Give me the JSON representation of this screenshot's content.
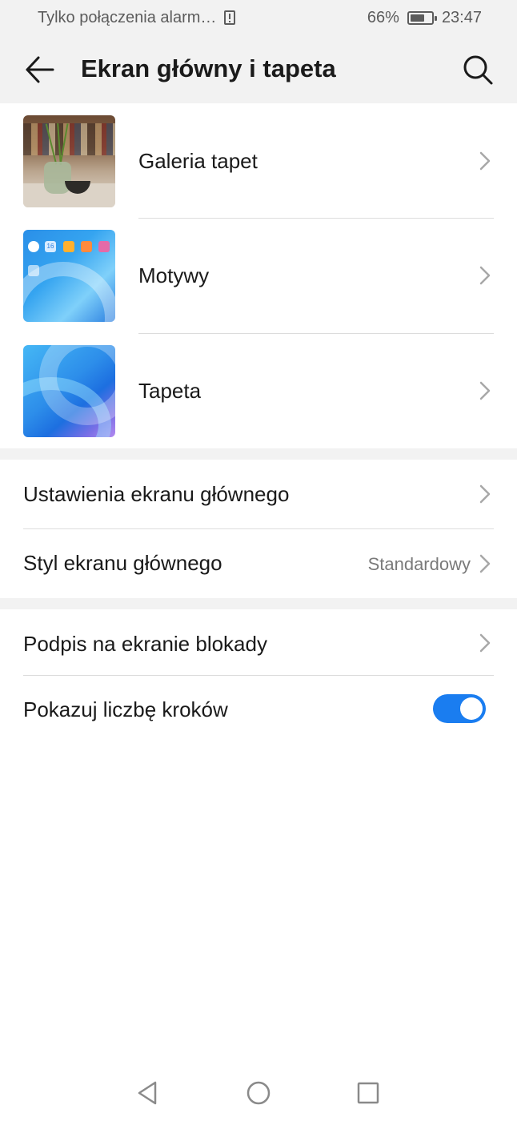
{
  "status_bar": {
    "carrier_text": "Tylko połączenia alarm…",
    "battery_percent": "66%",
    "battery_level": 0.66,
    "time": "23:47"
  },
  "app_bar": {
    "title": "Ekran główny i tapeta",
    "back_icon": "arrow-left-icon",
    "search_icon": "search-icon"
  },
  "thumbnail_items": [
    {
      "label": "Galeria tapet",
      "thumbnail": "wallpaper-gallery-thumbnail"
    },
    {
      "label": "Motywy",
      "thumbnail": "themes-thumbnail"
    },
    {
      "label": "Tapeta",
      "thumbnail": "wallpaper-thumbnail"
    }
  ],
  "home_settings": [
    {
      "label": "Ustawienia ekranu głównego",
      "value": ""
    },
    {
      "label": "Styl ekranu głównego",
      "value": "Standardowy"
    }
  ],
  "lock_settings": {
    "signature_label": "Podpis na ekranie blokady",
    "steps_label": "Pokazuj liczbę kroków",
    "steps_toggle_on": true
  },
  "theme_thumbnail_text": {
    "clock_date": "16"
  },
  "colors": {
    "accent": "#1a7df0",
    "header_bg": "#f2f2f2",
    "text_primary": "#1a1a1a",
    "text_secondary": "#7a7a7a"
  }
}
